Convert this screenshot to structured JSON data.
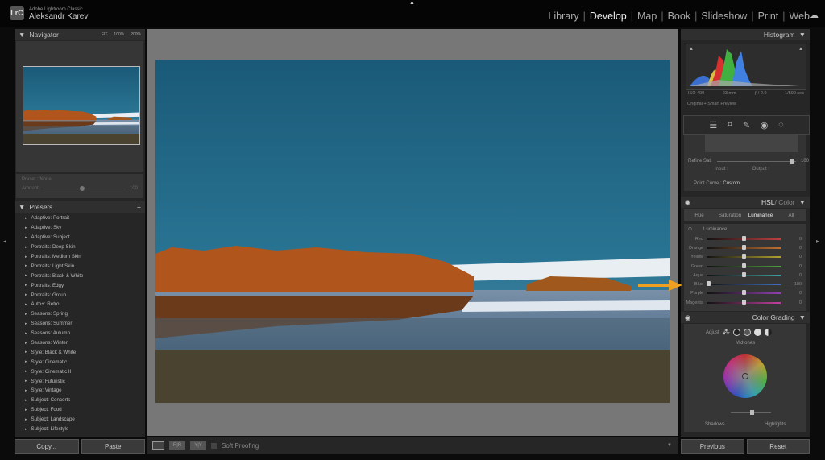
{
  "app": {
    "name": "Adobe Lightroom Classic",
    "logo": "LrC",
    "user": "Aleksandr Karev"
  },
  "modules": [
    "Library",
    "Develop",
    "Map",
    "Book",
    "Slideshow",
    "Print",
    "Web"
  ],
  "active_module": "Develop",
  "navigator": {
    "title": "Navigator",
    "zoom": [
      "FIT",
      "100%",
      "200%"
    ]
  },
  "preset_amount": {
    "preset_label": "Preset : None",
    "amount_label": "Amount",
    "amount_value": "100"
  },
  "presets": {
    "title": "Presets",
    "add": "+",
    "items": [
      "Adaptive: Portrait",
      "Adaptive: Sky",
      "Adaptive: Subject",
      "Portraits: Deep Skin",
      "Portraits: Medium Skin",
      "Portraits: Light Skin",
      "Portraits: Black & White",
      "Portraits: Edgy",
      "Portraits: Group",
      "Auto+: Retro",
      "Seasons: Spring",
      "Seasons: Summer",
      "Seasons: Autumn",
      "Seasons: Winter",
      "Style: Black & White",
      "Style: Cinematic",
      "Style: Cinematic II",
      "Style: Futuristic",
      "Style: Vintage",
      "Subject: Concerts",
      "Subject: Food",
      "Subject: Landscape",
      "Subject: Lifestyle"
    ]
  },
  "left_buttons": {
    "copy": "Copy...",
    "paste": "Paste"
  },
  "toolbar": {
    "soft_proofing": "Soft Proofing"
  },
  "histogram": {
    "title": "Histogram",
    "iso": "ISO 400",
    "focal": "23 mm",
    "aperture": "ƒ / 2.0",
    "shutter": "1/500 sec",
    "preview": "Original + Smart Preview"
  },
  "tone_curve": {
    "refine_sat_label": "Refine Sat.",
    "refine_sat_value": "100",
    "input": "Input :",
    "output": "Output :",
    "point_curve_label": "Point Curve :",
    "point_curve_value": "Custom"
  },
  "hsl": {
    "title_a": "HSL",
    "title_b": " / Color",
    "tabs": [
      "Hue",
      "Saturation",
      "Luminance",
      "All"
    ],
    "active_tab": "Luminance",
    "section": "Luminance",
    "sliders": [
      {
        "label": "Red",
        "value": "0",
        "pos": 0,
        "color": "#c04040"
      },
      {
        "label": "Orange",
        "value": "0",
        "pos": 0,
        "color": "#c07030"
      },
      {
        "label": "Yellow",
        "value": "0",
        "pos": 0,
        "color": "#b0a030"
      },
      {
        "label": "Green",
        "value": "0",
        "pos": 0,
        "color": "#50a040"
      },
      {
        "label": "Aqua",
        "value": "0",
        "pos": 0,
        "color": "#40a0a0"
      },
      {
        "label": "Blue",
        "value": "− 100",
        "pos": -100,
        "color": "#4070c0"
      },
      {
        "label": "Purple",
        "value": "0",
        "pos": 0,
        "color": "#9040b0"
      },
      {
        "label": "Magenta",
        "value": "0",
        "pos": 0,
        "color": "#c040a0"
      }
    ]
  },
  "color_grading": {
    "title": "Color Grading",
    "adjust": "Adjust",
    "midtones": "Midtones",
    "shadows": "Shadows",
    "highlights": "Highlights"
  },
  "right_buttons": {
    "previous": "Previous",
    "reset": "Reset"
  },
  "colors": {
    "accent_arrow": "#f0a020"
  }
}
